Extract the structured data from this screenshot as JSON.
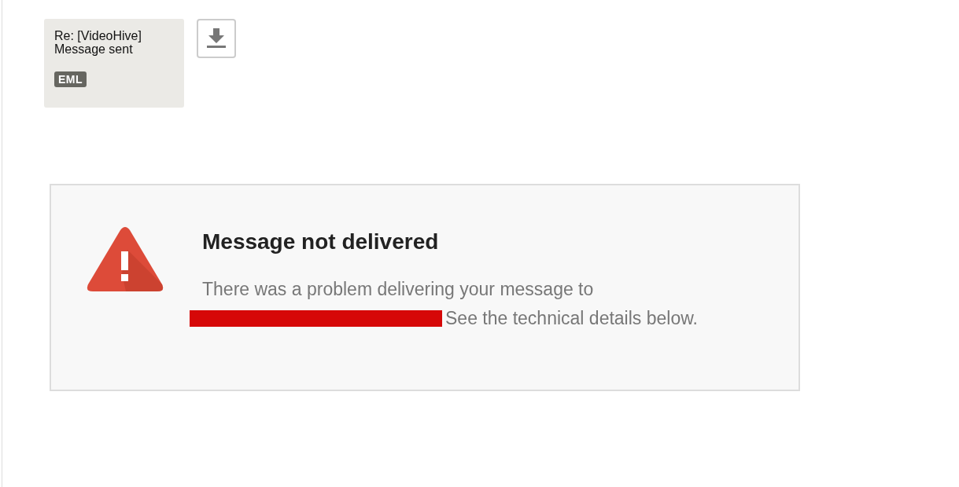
{
  "attachment": {
    "title": "Re: [VideoHive] Message sent",
    "type_badge": "EML"
  },
  "notice": {
    "title": "Message not delivered",
    "text_before": "There was a problem delivering your message to",
    "text_after": "See the technical details below."
  }
}
